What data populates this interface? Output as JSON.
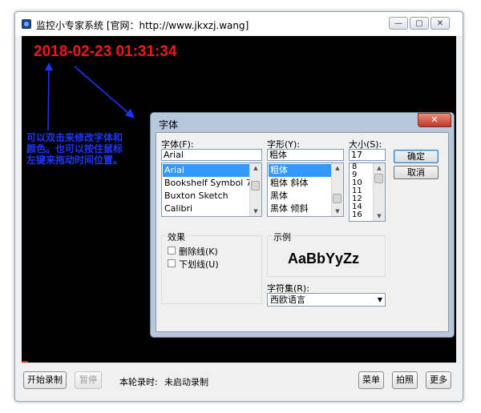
{
  "window": {
    "title": "监控小专家系统 [官网：http://www.jkxzj.wang]",
    "controls": [
      "—",
      "▢",
      "✕"
    ]
  },
  "overlay": {
    "clock_text": "2018-02-23 01:31:34",
    "hint_text": "可以双击来修改字体和颜色。也可以按住鼠标左键来拖动时间位置。"
  },
  "font_dialog": {
    "title": "字体",
    "close": "✕",
    "font_label": "字体(F):",
    "font_value": "Arial",
    "fonts": [
      "Arial",
      "Bookshelf Symbol 7",
      "Buxton Sketch",
      "Calibri"
    ],
    "style_label": "字形(Y):",
    "style_value": "粗体",
    "styles": [
      "粗体",
      "粗体 斜体",
      "黑体",
      "黑体 倾斜"
    ],
    "size_label": "大小(S):",
    "size_value": "17",
    "sizes": [
      "8",
      "9",
      "10",
      "11",
      "12",
      "14",
      "16"
    ],
    "ok": "确定",
    "cancel": "取消",
    "effects_label": "效果",
    "strikeout": "删除线(K)",
    "underline": "下划线(U)",
    "sample_label": "示例",
    "sample_text": "AaBbYyZz",
    "charset_label": "字符集(R):",
    "charset_value": "西欧语言"
  },
  "bottom_bar": {
    "start_record": "开始录制",
    "pause": "暂停",
    "status_label": "本轮录时:",
    "status_value": "未启动录制",
    "menu": "菜单",
    "snapshot": "拍照",
    "more": "更多"
  },
  "colors": {
    "clock": "#f01818",
    "hint": "#1e35ff",
    "arrows": "#1e35ff",
    "selection": "#3399ff"
  }
}
